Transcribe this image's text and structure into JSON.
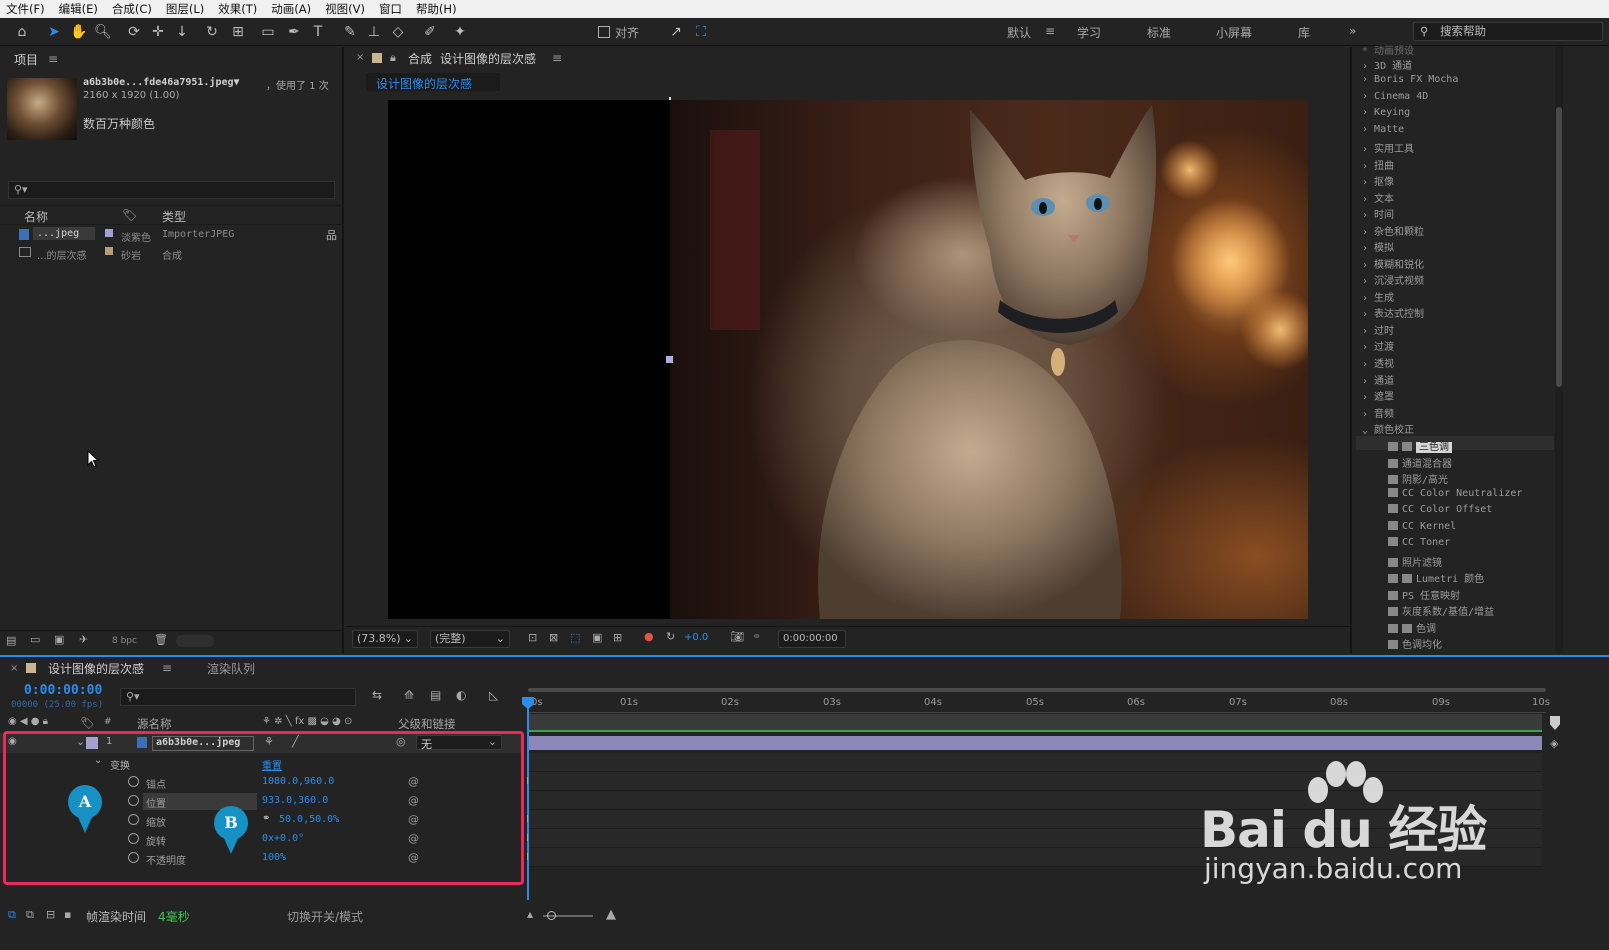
{
  "menu": [
    "文件(F)",
    "编辑(E)",
    "合成(C)",
    "图层(L)",
    "效果(T)",
    "动画(A)",
    "视图(V)",
    "窗口",
    "帮助(H)"
  ],
  "toolbar": {
    "align_label": "对齐",
    "workspaces": [
      "默认",
      "学习",
      "标准",
      "小屏幕",
      "库"
    ],
    "help_search": "搜索帮助"
  },
  "project": {
    "tab": "项目",
    "file_name": "a6b3b0e...fde46a7951.jpeg▼",
    "usage": "，使用了 1 次",
    "dimensions": "2160 x 1920 (1.00)",
    "colors": "数百万种颜色",
    "columns": {
      "name": "名称",
      "type": "类型"
    },
    "rows": [
      {
        "name": "...jpeg",
        "label": "淡紫色",
        "type": "ImporterJPEG"
      },
      {
        "name": "...的层次感",
        "label": "砂岩",
        "type": "合成"
      }
    ],
    "bpc": "8 bpc"
  },
  "viewer": {
    "tab_prefix": "合成",
    "comp_name": "设计图像的层次感",
    "zoom": "(73.8%)",
    "resolution": "(完整)",
    "exposure": "+0.0",
    "timecode": "0:00:00:00"
  },
  "effects": {
    "top_partial": "* 动画预设",
    "categories": [
      "3D 通道",
      "Boris FX Mocha",
      "Cinema 4D",
      "Keying",
      "Matte",
      "实用工具",
      "扭曲",
      "抠像",
      "文本",
      "时间",
      "杂色和颗粒",
      "模拟",
      "模糊和锐化",
      "沉浸式视频",
      "生成",
      "表达式控制",
      "过时",
      "过渡",
      "透视",
      "通道",
      "遮罩",
      "音频"
    ],
    "expanded": "颜色校正",
    "items": [
      "三色调",
      "通道混合器",
      "阴影/高光",
      "CC Color Neutralizer",
      "CC Color Offset",
      "CC Kernel",
      "CC Toner",
      "照片滤镜",
      "Lumetri 颜色",
      "PS 任意映射",
      "灰度系数/基值/增益",
      "色调",
      "色调均化"
    ]
  },
  "timeline": {
    "tab": "设计图像的层次感",
    "render_queue": "渲染队列",
    "time": "0:00:00:00",
    "fps": "00000 (25.00 fps)",
    "col_source": "源名称",
    "col_parent": "父级和链接",
    "layer": {
      "index": "1",
      "name": "a6b3b0e...jpeg",
      "parent": "无"
    },
    "transform": {
      "label": "变换",
      "reset": "重置"
    },
    "properties": [
      {
        "name": "锚点",
        "value": "1080.0,960.0"
      },
      {
        "name": "位置",
        "value": "933.0,360.0"
      },
      {
        "name": "缩放",
        "value": "50.0,50.0%"
      },
      {
        "name": "旋转",
        "value": "0x+0.0°"
      },
      {
        "name": "不透明度",
        "value": "100%"
      }
    ],
    "ticks": [
      "0s",
      "01s",
      "02s",
      "03s",
      "04s",
      "05s",
      "06s",
      "07s",
      "08s",
      "09s",
      "10s"
    ],
    "status": {
      "label": "帧渲染时间",
      "value": "4毫秒",
      "toggle": "切换开关/模式"
    }
  },
  "annotations": {
    "a": "A",
    "b": "B"
  },
  "watermark": {
    "brand": "Bai du 经验",
    "url": "jingyan.baidu.com"
  }
}
